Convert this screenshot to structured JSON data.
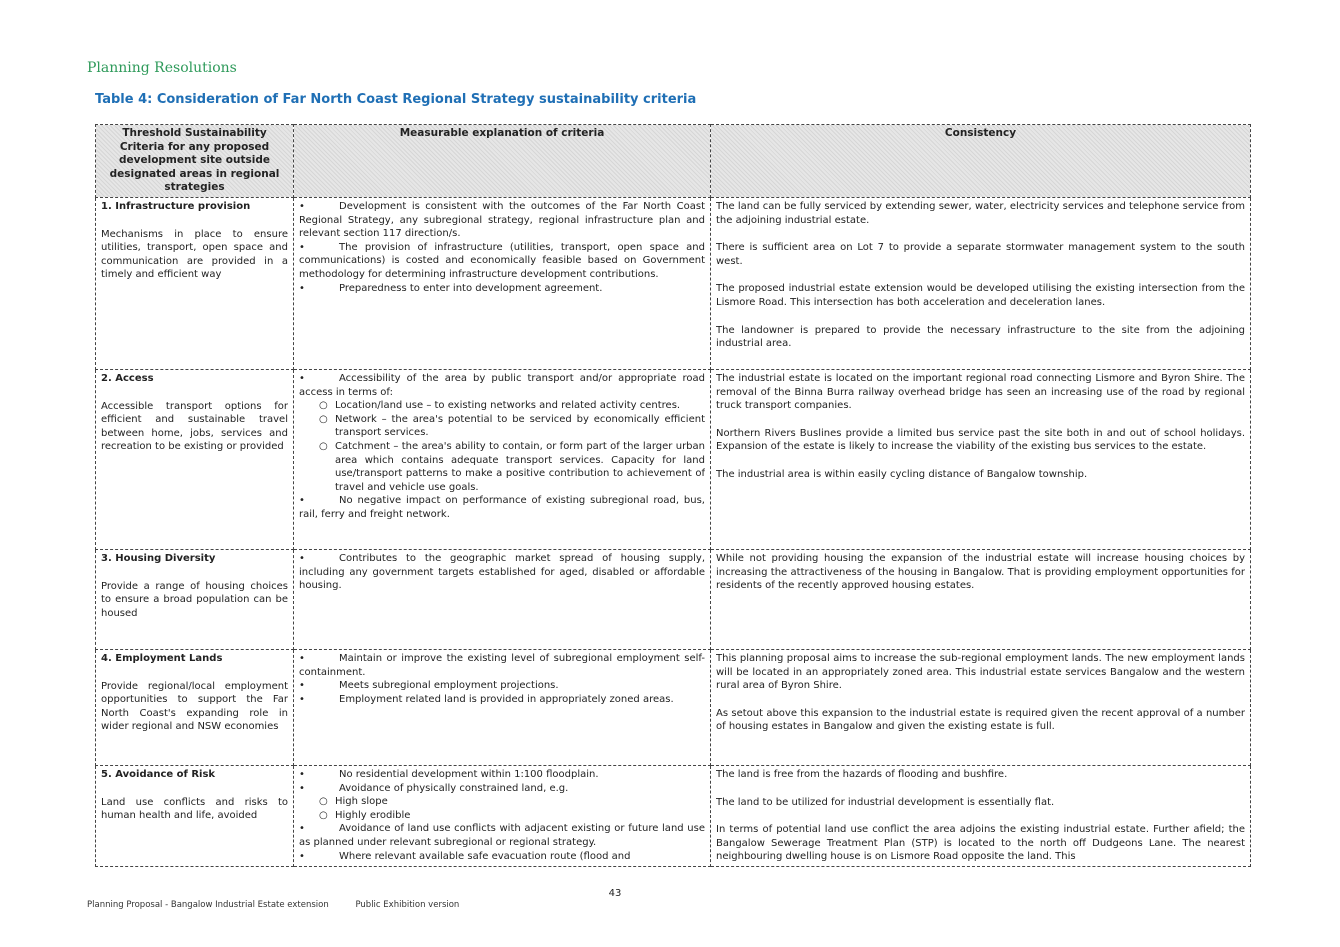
{
  "header": {
    "section": "Planning Resolutions",
    "table_title": "Table 4: Consideration of Far North Coast Regional Strategy sustainability criteria"
  },
  "columns": [
    "Threshold Sustainability Criteria for any proposed development site outside designated areas in regional strategies",
    "Measurable explanation of criteria",
    "Consistency"
  ],
  "rows": [
    {
      "title": "1.  Infrastructure provision",
      "desc": "Mechanisms in place to ensure utilities, transport, open space and communication are provided in a timely and efficient way",
      "measures": [
        {
          "type": "bullet",
          "text": "Development is consistent with the outcomes of the Far North Coast Regional Strategy, any subregional strategy, regional infrastructure plan and relevant section 117 direction/s."
        },
        {
          "type": "bullet",
          "text": "The provision of infrastructure (utilities, transport, open space and communications) is costed and economically feasible based on Government methodology for determining infrastructure development contributions."
        },
        {
          "type": "bullet",
          "text": "Preparedness to enter into development agreement."
        }
      ],
      "consistency": [
        "The land can be fully serviced by extending sewer, water, electricity services and telephone service from the adjoining industrial estate.",
        "There is sufficient area on Lot 7 to provide a separate stormwater management system to the south west.",
        "The proposed industrial estate extension would be developed utilising the existing intersection from the Lismore Road.   This intersection has both acceleration and deceleration lanes.",
        "The landowner is prepared to provide the necessary infrastructure to the site from the adjoining industrial area."
      ]
    },
    {
      "title": "2.  Access",
      "desc": "Accessible transport options for efficient and sustainable travel between home, jobs, services and recreation to be existing or provided",
      "measures": [
        {
          "type": "bullet",
          "text": "Accessibility of the area by public transport and/or appropriate road access in terms of:"
        },
        {
          "type": "sub",
          "text": "Location/land use – to existing networks and related activity centres."
        },
        {
          "type": "sub",
          "text": "Network – the area's potential to be serviced by economically efficient transport services."
        },
        {
          "type": "sub",
          "text": "Catchment – the area's ability to contain, or form part of the larger urban area which contains adequate transport services. Capacity for land use/transport patterns to make a positive contribution to achievement of travel and vehicle use goals."
        },
        {
          "type": "bullet",
          "text": "No negative impact on performance of existing subregional road, bus, rail, ferry and freight network."
        }
      ],
      "consistency": [
        "The industrial estate is located on the important regional road connecting Lismore and Byron Shire.  The removal of the Binna Burra railway overhead bridge has seen an increasing use of the road by regional truck transport companies.",
        "Northern Rivers Buslines provide a limited bus service past the site both in and out of school holidays.   Expansion of the estate is likely to increase the viability of the existing bus services to the estate.",
        "The industrial area is within easily cycling distance of Bangalow township."
      ]
    },
    {
      "title": "3.  Housing Diversity",
      "desc": "Provide a range of housing choices to ensure a broad population can be housed",
      "measures": [
        {
          "type": "bullet",
          "text": "Contributes to the geographic market spread of housing supply, including any government targets established for aged, disabled or affordable housing."
        }
      ],
      "consistency": [
        "While not providing housing the expansion of the industrial estate will increase housing choices by increasing the attractiveness of the housing in Bangalow.   That is providing employment opportunities for residents of the recently approved housing estates."
      ]
    },
    {
      "title": "4.  Employment Lands",
      "desc": "Provide regional/local employment opportunities to support the Far North Coast's expanding role in wider regional and NSW economies",
      "measures": [
        {
          "type": "bullet",
          "text": "Maintain or improve the existing level of subregional employment self-containment."
        },
        {
          "type": "bullet",
          "text": "Meets subregional employment projections."
        },
        {
          "type": "bullet",
          "text": "Employment related land is provided in appropriately zoned areas."
        }
      ],
      "consistency": [
        "This planning proposal aims to increase the sub-regional employment lands.   The new employment lands will be located in an appropriately zoned area. This industrial estate services Bangalow and the western rural area of Byron Shire.",
        "As setout above this expansion to the industrial estate is required given the recent approval of a number of housing estates in Bangalow and given the existing estate is full."
      ]
    },
    {
      "title": "5.  Avoidance of Risk",
      "desc": "Land use conflicts and risks to human health and life, avoided",
      "measures": [
        {
          "type": "bullet",
          "text": "No residential development within 1:100 floodplain."
        },
        {
          "type": "bullet",
          "text": "Avoidance of physically constrained land, e.g."
        },
        {
          "type": "sub",
          "text": "High slope"
        },
        {
          "type": "sub",
          "text": "Highly erodible"
        },
        {
          "type": "bullet",
          "text": "Avoidance of land use conflicts with adjacent existing or future land use as planned under relevant subregional or regional strategy."
        },
        {
          "type": "bullet",
          "text": "Where relevant available safe evacuation route (flood and"
        }
      ],
      "consistency": [
        "The land is free from the hazards of flooding and bushfire.",
        "The land to be utilized for industrial development is essentially flat.",
        "In terms of potential land use conflict the area adjoins the existing industrial estate.  Further afield; the Bangalow Sewerage Treatment Plan (STP) is located to the north off Dudgeons Lane.  The nearest neighbouring dwelling house is on Lismore Road opposite the land.  This"
      ]
    }
  ],
  "page_number": "43",
  "footer": {
    "left": "Planning Proposal - Bangalow Industrial Estate extension",
    "right": "Public Exhibition version"
  }
}
